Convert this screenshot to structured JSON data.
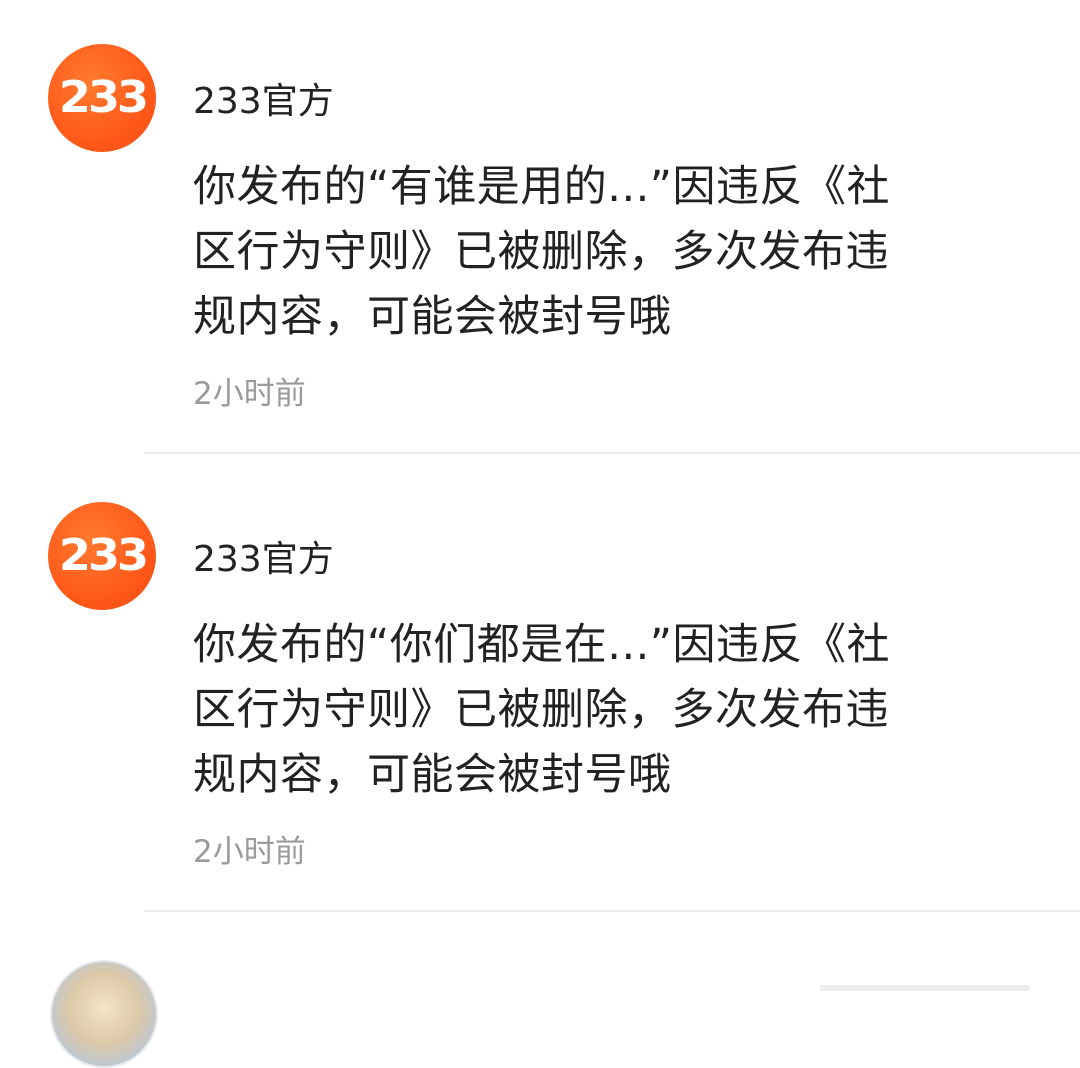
{
  "messages": [
    {
      "avatar_text": "233",
      "sender": "233官方",
      "content_lines": [
        "你发布的“有谁是用的...”因违反《社",
        "区行为守则》已被删除，多次发布违",
        "规内容，可能会被封号哦"
      ],
      "time": "2小时前"
    },
    {
      "avatar_text": "233",
      "sender": "233官方",
      "content_lines": [
        "你发布的“你们都是在...”因违反《社",
        "区行为守则》已被删除，多次发布违",
        "规内容，可能会被封号哦"
      ],
      "time": "2小时前"
    }
  ],
  "colors": {
    "avatar_orange": "#ff5a1a",
    "text_primary": "#222222",
    "text_secondary": "#9a9a9a",
    "divider": "#ececec"
  }
}
